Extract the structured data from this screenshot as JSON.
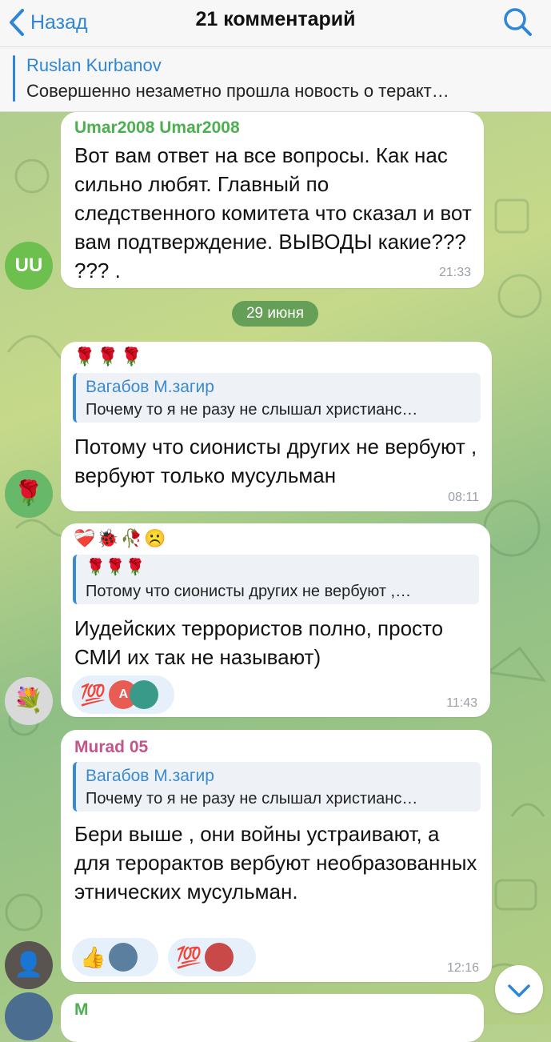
{
  "header": {
    "back_label": "Назад",
    "title": "21 комментарий"
  },
  "pinned": {
    "name": "Ruslan Kurbanov",
    "text": "Совершенно незаметно прошла новость о теракт…"
  },
  "messages": [
    {
      "sender": "Umar2008 Umar2008",
      "sender_color": "#4caf50",
      "avatar_text": "UU",
      "text": "Вот вам ответ на все вопросы. Как нас сильно любят. Главный по следственного комитета что сказал и вот вам подтверждение. ВЫВОДЫ какие??? ??? .",
      "time": "21:33"
    },
    {
      "top_emoji": "🌹🌹🌹",
      "reply_name": "Вагабов М.загир",
      "reply_text": "Почему то я не разу не слышал христианс…",
      "text": "Потому что сионисты других не вербуют , вербуют только мусульман",
      "time": "08:11"
    },
    {
      "top_emoji": "❤️‍🩹🐞🥀☹️",
      "reply_emoji": "🌹🌹🌹",
      "reply_text": "Потому что сионисты других не вербуют ,…",
      "text": "Иудейских террористов полно, просто СМИ их так не называют)",
      "reaction_emoji": "💯",
      "reaction_avatar_letter": "A",
      "time": "11:43"
    },
    {
      "sender": "Murad 05",
      "sender_color": "#c2558a",
      "reply_name": "Вагабов М.загир",
      "reply_text": "Почему то я не разу не слышал христианс…",
      "text": "Бери выше , они войны устраивают, а для терорактов вербуют необразованных этнических мусульман.",
      "reaction1_emoji": "👍",
      "reaction2_emoji": "💯",
      "time": "12:16"
    },
    {
      "sender": "M",
      "sender_color": "#4caf50"
    }
  ],
  "date_separator": "29 июня",
  "colors": {
    "accent": "#2f86d6",
    "bubble": "#ffffff",
    "date_pill": "#4e9a4e"
  }
}
